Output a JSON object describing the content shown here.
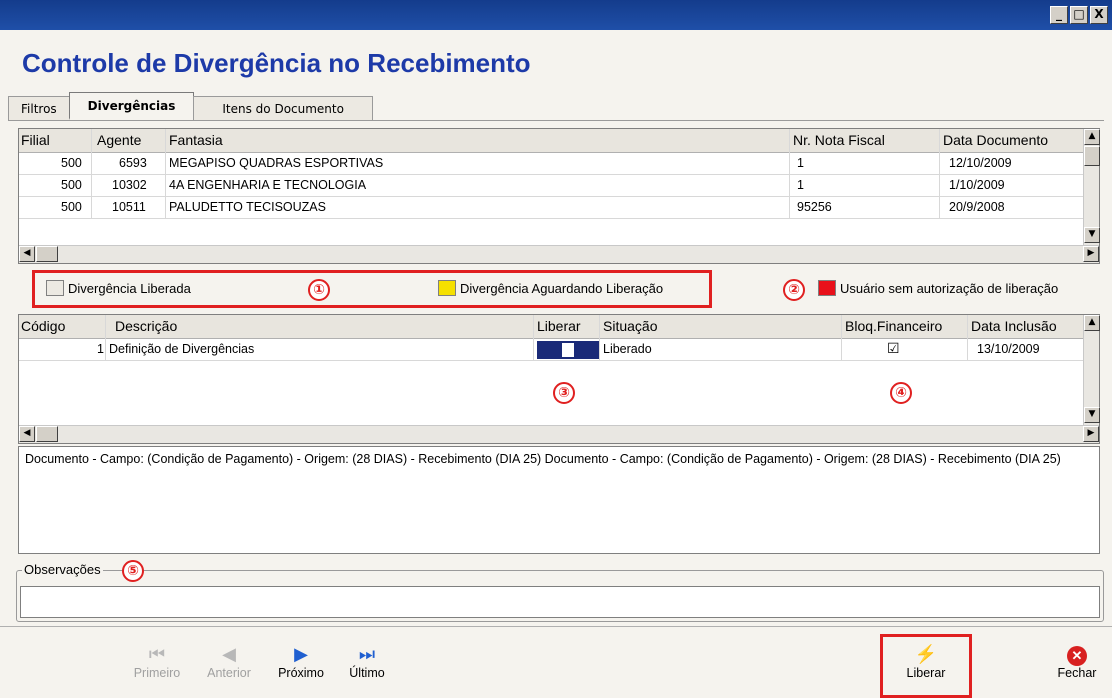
{
  "window": {
    "min": "_",
    "max": "□",
    "close": "X"
  },
  "app_title": "Controle de Divergência no Recebimento",
  "tabs": [
    "Filtros",
    "Divergências",
    "Itens do Documento"
  ],
  "docs_grid": {
    "columns": [
      "Filial",
      "Agente",
      "Fantasia",
      "Nr. Nota Fiscal",
      "Data Documento"
    ],
    "rows": [
      {
        "filial": "500",
        "agente": "6593",
        "fantasia": "MEGAPISO QUADRAS ESPORTIVAS",
        "nota": "1",
        "data": "12/10/2009"
      },
      {
        "filial": "500",
        "agente": "10302",
        "fantasia": "4A ENGENHARIA E TECNOLOGIA",
        "nota": "1",
        "data": "1/10/2009"
      },
      {
        "filial": "500",
        "agente": "10511",
        "fantasia": "PALUDETTO TECISOUZAS",
        "nota": "95256",
        "data": "20/9/2008"
      }
    ]
  },
  "legend": {
    "liberada": "Divergência Liberada",
    "aguardando": "Divergência Aguardando Liberação",
    "sem_autorizacao": "Usuário sem autorização de liberação",
    "colors": {
      "liberada": "#ece9e2",
      "aguardando": "#f5e000",
      "sem_autorizacao": "#e8101a"
    }
  },
  "markers": [
    "①",
    "②",
    "③",
    "④",
    "⑤"
  ],
  "div_grid": {
    "columns": [
      "Código",
      "Descrição",
      "Liberar",
      "Situação",
      "Bloq.Financeiro",
      "Data Inclusão"
    ],
    "rows": [
      {
        "codigo": "1",
        "descricao": "Definição de Divergências",
        "situacao": "Liberado",
        "bloq": "☑",
        "data": "13/10/2009"
      }
    ]
  },
  "details_text": "Documento - Campo: (Condição de Pagamento) - Origem: (28 DIAS) - Recebimento (DIA 25) Documento - Campo: (Condição de Pagamento) - Origem: (28 DIAS) - Recebimento (DIA 25)",
  "observacoes_label": "Observações",
  "nav": {
    "primeiro": "Primeiro",
    "anterior": "Anterior",
    "proximo": "Próximo",
    "ultimo": "Último",
    "liberar": "Liberar",
    "fechar": "Fechar"
  },
  "accent_red": "#e02020",
  "title_color": "#1d3aa8"
}
